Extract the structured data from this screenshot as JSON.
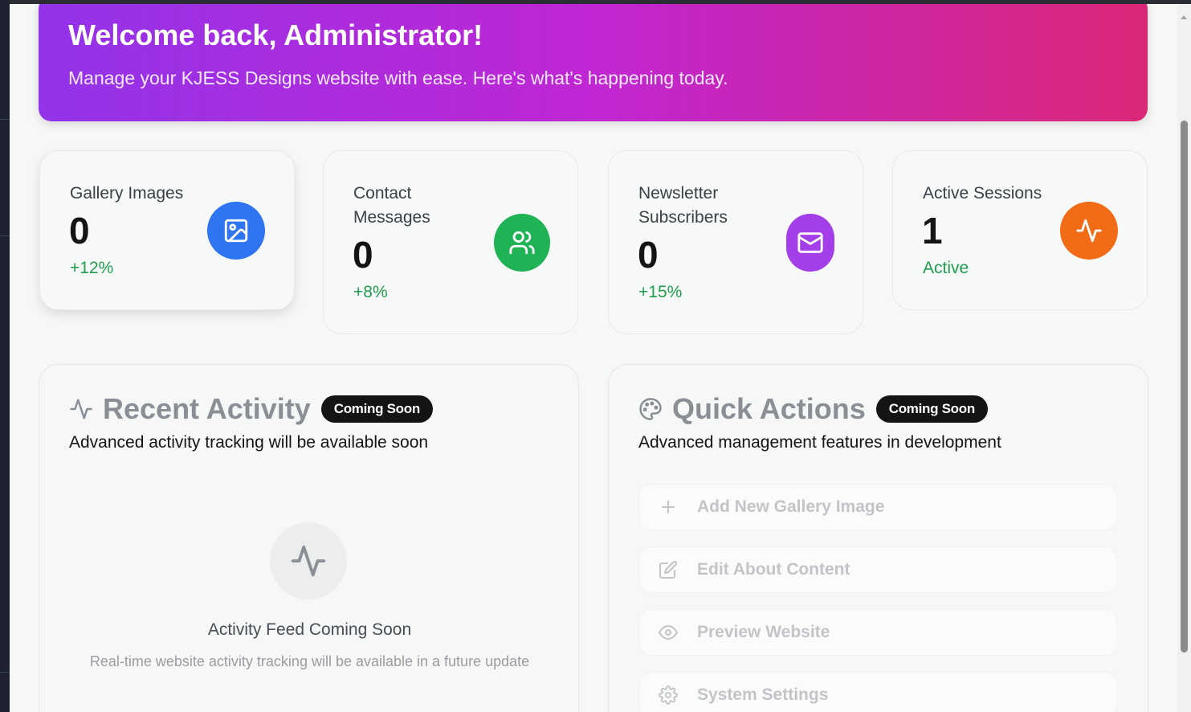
{
  "welcome": {
    "title": "Welcome back, Administrator!",
    "subtitle": "Manage your KJESS Designs website with ease. Here's what's happening today."
  },
  "stats": [
    {
      "label": "Gallery Images",
      "value": "0",
      "change": "+12%",
      "icon": "image-icon",
      "color": "#2f74f0"
    },
    {
      "label": "Contact Messages",
      "value": "0",
      "change": "+8%",
      "icon": "users-icon",
      "color": "#1fb355"
    },
    {
      "label": "Newsletter Subscribers",
      "value": "0",
      "change": "+15%",
      "icon": "mail-icon",
      "color": "#a43ee8"
    },
    {
      "label": "Active Sessions",
      "value": "1",
      "change": "Active",
      "icon": "activity-icon",
      "color": "#f26b17"
    }
  ],
  "activity": {
    "title": "Recent Activity",
    "badge": "Coming Soon",
    "subtitle": "Advanced activity tracking will be available soon",
    "feed_title": "Activity Feed Coming Soon",
    "feed_desc": "Real-time website activity tracking will be available in a future update"
  },
  "quick_actions": {
    "title": "Quick Actions",
    "badge": "Coming Soon",
    "subtitle": "Advanced management features in development",
    "items": [
      {
        "label": "Add New Gallery Image",
        "icon": "plus-icon"
      },
      {
        "label": "Edit About Content",
        "icon": "edit-icon"
      },
      {
        "label": "Preview Website",
        "icon": "eye-icon"
      },
      {
        "label": "System Settings",
        "icon": "settings-icon"
      }
    ]
  }
}
